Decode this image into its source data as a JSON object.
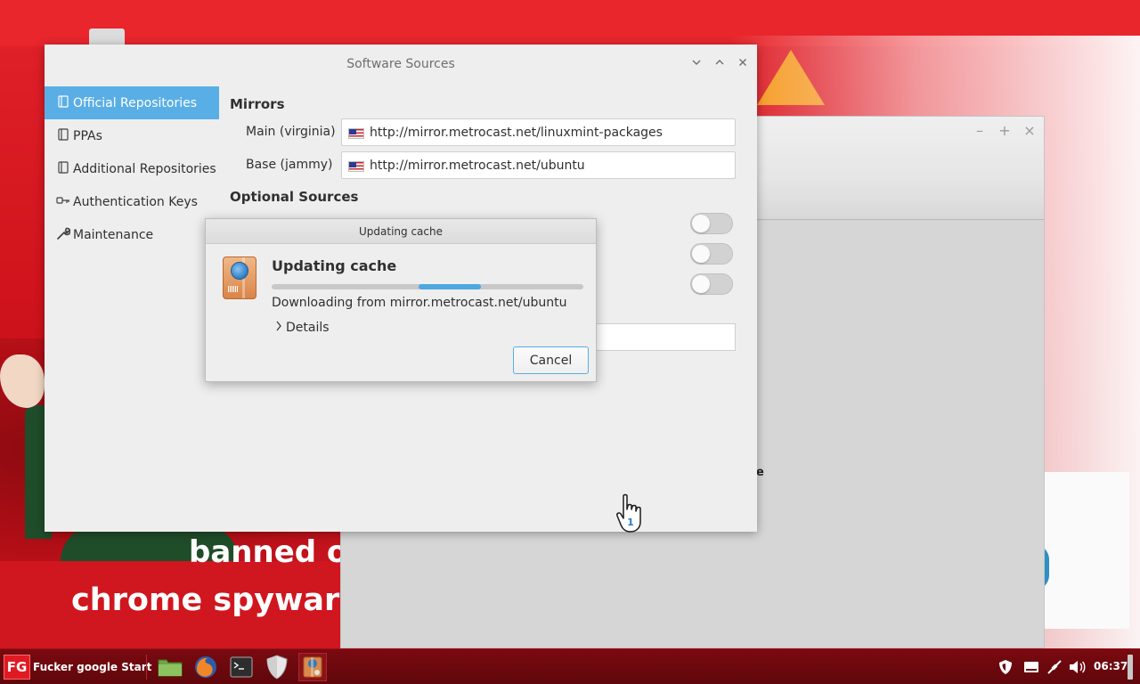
{
  "wallpaper": {
    "line1": "banned o",
    "line2": "chrome spyware"
  },
  "background_window": {
    "partial_text": "e"
  },
  "main_window": {
    "title": "Software Sources",
    "sidebar": {
      "items": [
        {
          "label": "Official Repositories",
          "icon": "repository-icon",
          "active": true
        },
        {
          "label": "PPAs",
          "icon": "repository-icon",
          "active": false
        },
        {
          "label": "Additional Repositories",
          "icon": "repository-icon",
          "active": false
        },
        {
          "label": "Authentication Keys",
          "icon": "key-icon",
          "active": false
        },
        {
          "label": "Maintenance",
          "icon": "wrench-icon",
          "active": false
        }
      ]
    },
    "mirrors": {
      "heading": "Mirrors",
      "main": {
        "label": "Main (virginia)",
        "url": "http://mirror.metrocast.net/linuxmint-packages"
      },
      "base": {
        "label": "Base (jammy)",
        "url": "http://mirror.metrocast.net/ubuntu"
      }
    },
    "optional_sources": {
      "heading": "Optional Sources",
      "toggles": [
        false,
        false,
        false
      ]
    }
  },
  "dialog": {
    "title": "Updating cache",
    "heading": "Updating cache",
    "progress": {
      "start": 0.47,
      "end": 0.67
    },
    "status": "Downloading from mirror.metrocast.net/ubuntu",
    "details_label": "Details",
    "cancel_label": "Cancel"
  },
  "cursor": {
    "badge": "1"
  },
  "taskbar": {
    "start_logo": "FG",
    "start_label": "Fucker google Start",
    "launchers": [
      "folder-icon",
      "firefox-icon",
      "terminal-icon",
      "shield-icon",
      "software-sources-icon"
    ],
    "clock": "06:37"
  },
  "colors": {
    "accent": "#5aaee6",
    "wallpaper_red": "#d0131c",
    "taskbar": "#6a080d"
  }
}
